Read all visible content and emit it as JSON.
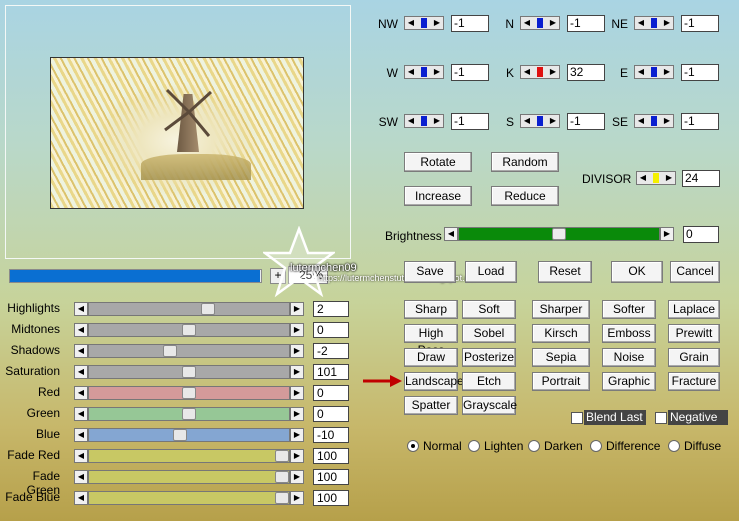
{
  "preview": {
    "zoom": "25%",
    "progress_fraction": 0.995
  },
  "watermark": {
    "text": "lutermchen09",
    "url": "https://lutermchenstutorials.blogspot.de/"
  },
  "sliders": [
    {
      "label": "Highlights",
      "value": "2",
      "level": 0.6,
      "track": "#a8a8a8"
    },
    {
      "label": "Midtones",
      "value": "0",
      "level": 0.5,
      "track": "#a8a8a8"
    },
    {
      "label": "Shadows",
      "value": "-2",
      "level": 0.4,
      "track": "#a8a8a8"
    },
    {
      "label": "Saturation",
      "value": "101",
      "level": 0.5,
      "track": "#a8a8a8"
    },
    {
      "label": "Red",
      "value": "0",
      "level": 0.5,
      "track": "#d49a9a"
    },
    {
      "label": "Green",
      "value": "0",
      "level": 0.5,
      "track": "#96c796"
    },
    {
      "label": "Blue",
      "value": "-10",
      "level": 0.45,
      "track": "#84a6d2"
    },
    {
      "label": "Fade Red",
      "value": "100",
      "level": 1.0,
      "track": "#c8c864"
    },
    {
      "label": "Fade Green",
      "value": "100",
      "level": 1.0,
      "track": "#c8c864"
    },
    {
      "label": "Fade Blue",
      "value": "100",
      "level": 1.0,
      "track": "#c8c864"
    }
  ],
  "kernel": [
    {
      "label": "NW",
      "value": "-1"
    },
    {
      "label": "N",
      "value": "-1"
    },
    {
      "label": "NE",
      "value": "-1"
    },
    {
      "label": "W",
      "value": "-1"
    },
    {
      "label": "K",
      "value": "32",
      "accent": "#e01010"
    },
    {
      "label": "E",
      "value": "-1"
    },
    {
      "label": "SW",
      "value": "-1"
    },
    {
      "label": "S",
      "value": "-1"
    },
    {
      "label": "SE",
      "value": "-1"
    }
  ],
  "divisor": {
    "label": "DIVISOR",
    "value": "24",
    "accent": "#f4f000"
  },
  "buttons": {
    "rotate": "Rotate",
    "random": "Random",
    "increase": "Increase",
    "reduce": "Reduce",
    "save": "Save",
    "load": "Load",
    "reset": "Reset",
    "ok": "OK",
    "cancel": "Cancel"
  },
  "brightness": {
    "label": "Brightness",
    "value": "0",
    "level": 0.5
  },
  "presets": [
    [
      "Sharp",
      "Soft",
      "Sharper",
      "Softer",
      "Laplace"
    ],
    [
      "High Pass",
      "Sobel",
      "Kirsch",
      "Emboss",
      "Prewitt"
    ],
    [
      "Draw",
      "Posterize",
      "Sepia",
      "Noise",
      "Grain"
    ],
    [
      "Landscape",
      "Etch",
      "Portrait",
      "Graphic",
      "Fracture"
    ],
    [
      "Spatter",
      "Grayscale"
    ]
  ],
  "options": {
    "blend_last": "Blend Last",
    "negative": "Negative"
  },
  "modes": [
    "Normal",
    "Lighten",
    "Darken",
    "Difference",
    "Diffuse"
  ],
  "selected_mode": "Normal",
  "colors": {
    "kernel_marker": "#0a1fd0",
    "brightness_track": "#0a8a0a",
    "progress": "#0a6fd2",
    "annotation_arrow": "#c00000"
  }
}
